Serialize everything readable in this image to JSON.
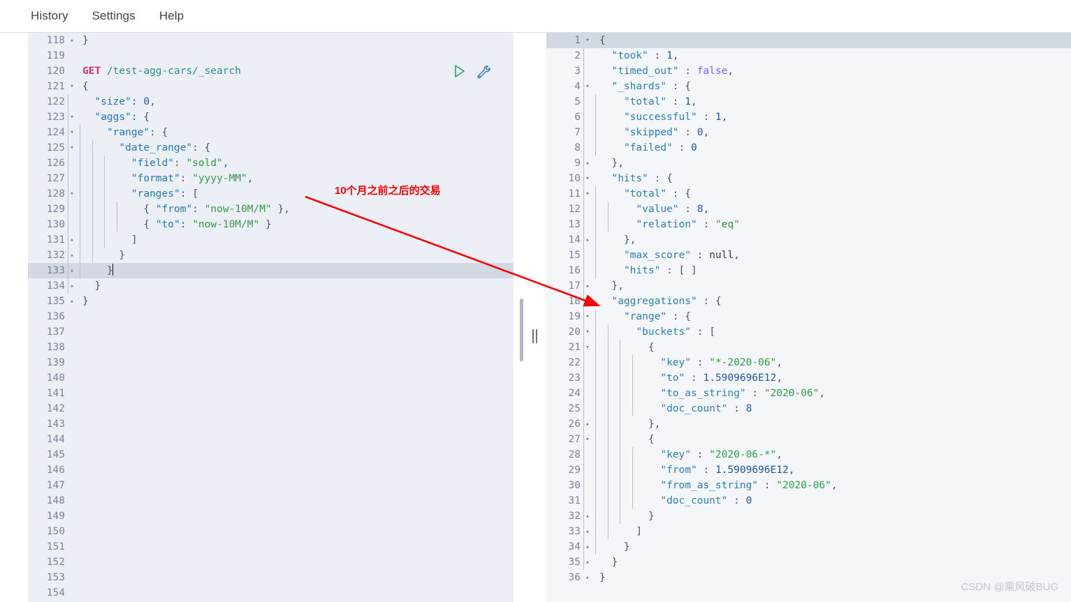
{
  "menu": {
    "items": [
      {
        "label": "History",
        "name": "menu-history"
      },
      {
        "label": "Settings",
        "name": "menu-settings"
      },
      {
        "label": "Help",
        "name": "menu-help"
      }
    ]
  },
  "request_editor": {
    "method": "GET",
    "path": "/test-agg-cars/_search",
    "active_line": 133,
    "first_line": 118,
    "last_line": 154,
    "actions": {
      "play_label": "send-request",
      "wrench_label": "request-options"
    },
    "lines": [
      {
        "n": 118,
        "fold": "up",
        "text": "}"
      },
      {
        "n": 119,
        "fold": "",
        "text": ""
      },
      {
        "n": 120,
        "fold": "",
        "text": "GET /test-agg-cars/_search"
      },
      {
        "n": 121,
        "fold": "down",
        "text": "{"
      },
      {
        "n": 122,
        "fold": "",
        "text": "  \"size\": 0,"
      },
      {
        "n": 123,
        "fold": "down",
        "text": "  \"aggs\": {"
      },
      {
        "n": 124,
        "fold": "down",
        "text": "    \"range\": {"
      },
      {
        "n": 125,
        "fold": "down",
        "text": "      \"date_range\": {"
      },
      {
        "n": 126,
        "fold": "",
        "text": "        \"field\": \"sold\","
      },
      {
        "n": 127,
        "fold": "",
        "text": "        \"format\": \"yyyy-MM\","
      },
      {
        "n": 128,
        "fold": "down",
        "text": "        \"ranges\": ["
      },
      {
        "n": 129,
        "fold": "",
        "text": "          { \"from\": \"now-10M/M\" },"
      },
      {
        "n": 130,
        "fold": "",
        "text": "          { \"to\": \"now-10M/M\" }"
      },
      {
        "n": 131,
        "fold": "up",
        "text": "        ]"
      },
      {
        "n": 132,
        "fold": "up",
        "text": "      }"
      },
      {
        "n": 133,
        "fold": "up",
        "text": "    }"
      },
      {
        "n": 134,
        "fold": "up",
        "text": "  }"
      },
      {
        "n": 135,
        "fold": "up",
        "text": "}"
      },
      {
        "n": 136,
        "fold": "",
        "text": ""
      },
      {
        "n": 137,
        "fold": "",
        "text": ""
      },
      {
        "n": 138,
        "fold": "",
        "text": ""
      },
      {
        "n": 139,
        "fold": "",
        "text": ""
      },
      {
        "n": 140,
        "fold": "",
        "text": ""
      },
      {
        "n": 141,
        "fold": "",
        "text": ""
      },
      {
        "n": 142,
        "fold": "",
        "text": ""
      },
      {
        "n": 143,
        "fold": "",
        "text": ""
      },
      {
        "n": 144,
        "fold": "",
        "text": ""
      },
      {
        "n": 145,
        "fold": "",
        "text": ""
      },
      {
        "n": 146,
        "fold": "",
        "text": ""
      },
      {
        "n": 147,
        "fold": "",
        "text": ""
      },
      {
        "n": 148,
        "fold": "",
        "text": ""
      },
      {
        "n": 149,
        "fold": "",
        "text": ""
      },
      {
        "n": 150,
        "fold": "",
        "text": ""
      },
      {
        "n": 151,
        "fold": "",
        "text": ""
      },
      {
        "n": 152,
        "fold": "",
        "text": ""
      },
      {
        "n": 153,
        "fold": "",
        "text": ""
      },
      {
        "n": 154,
        "fold": "",
        "text": ""
      }
    ]
  },
  "response_viewer": {
    "active_line": 1,
    "lines": [
      {
        "n": 1,
        "fold": "down",
        "text": "{"
      },
      {
        "n": 2,
        "fold": "",
        "text": "  \"took\" : 1,"
      },
      {
        "n": 3,
        "fold": "",
        "text": "  \"timed_out\" : false,"
      },
      {
        "n": 4,
        "fold": "down",
        "text": "  \"_shards\" : {"
      },
      {
        "n": 5,
        "fold": "",
        "text": "    \"total\" : 1,"
      },
      {
        "n": 6,
        "fold": "",
        "text": "    \"successful\" : 1,"
      },
      {
        "n": 7,
        "fold": "",
        "text": "    \"skipped\" : 0,"
      },
      {
        "n": 8,
        "fold": "",
        "text": "    \"failed\" : 0"
      },
      {
        "n": 9,
        "fold": "up",
        "text": "  },"
      },
      {
        "n": 10,
        "fold": "down",
        "text": "  \"hits\" : {"
      },
      {
        "n": 11,
        "fold": "down",
        "text": "    \"total\" : {"
      },
      {
        "n": 12,
        "fold": "",
        "text": "      \"value\" : 8,"
      },
      {
        "n": 13,
        "fold": "",
        "text": "      \"relation\" : \"eq\""
      },
      {
        "n": 14,
        "fold": "up",
        "text": "    },"
      },
      {
        "n": 15,
        "fold": "",
        "text": "    \"max_score\" : null,"
      },
      {
        "n": 16,
        "fold": "",
        "text": "    \"hits\" : [ ]"
      },
      {
        "n": 17,
        "fold": "up",
        "text": "  },"
      },
      {
        "n": 18,
        "fold": "down",
        "text": "  \"aggregations\" : {"
      },
      {
        "n": 19,
        "fold": "down",
        "text": "    \"range\" : {"
      },
      {
        "n": 20,
        "fold": "down",
        "text": "      \"buckets\" : ["
      },
      {
        "n": 21,
        "fold": "down",
        "text": "        {"
      },
      {
        "n": 22,
        "fold": "",
        "text": "          \"key\" : \"*-2020-06\","
      },
      {
        "n": 23,
        "fold": "",
        "text": "          \"to\" : 1.5909696E12,"
      },
      {
        "n": 24,
        "fold": "",
        "text": "          \"to_as_string\" : \"2020-06\","
      },
      {
        "n": 25,
        "fold": "",
        "text": "          \"doc_count\" : 8"
      },
      {
        "n": 26,
        "fold": "up",
        "text": "        },"
      },
      {
        "n": 27,
        "fold": "down",
        "text": "        {"
      },
      {
        "n": 28,
        "fold": "",
        "text": "          \"key\" : \"2020-06-*\","
      },
      {
        "n": 29,
        "fold": "",
        "text": "          \"from\" : 1.5909696E12,"
      },
      {
        "n": 30,
        "fold": "",
        "text": "          \"from_as_string\" : \"2020-06\","
      },
      {
        "n": 31,
        "fold": "",
        "text": "          \"doc_count\" : 0"
      },
      {
        "n": 32,
        "fold": "up",
        "text": "        }"
      },
      {
        "n": 33,
        "fold": "up",
        "text": "      ]"
      },
      {
        "n": 34,
        "fold": "up",
        "text": "    }"
      },
      {
        "n": 35,
        "fold": "up",
        "text": "  }"
      },
      {
        "n": 36,
        "fold": "up",
        "text": "}"
      }
    ]
  },
  "annotation": {
    "text": "10个月之前之后的交易",
    "color": "#ff0000"
  },
  "watermark": {
    "text": "CSDN @乘风破BUG"
  },
  "colors": {
    "editor_bg": "#edeff7",
    "response_bg": "#f5f6fa",
    "active_line": "#d3d9e3",
    "gutter_text": "#77849a",
    "method": "#d6336c",
    "url": "#2f8f8f",
    "key": "#1f7ab5",
    "string": "#2f9e44",
    "number": "#2257a8",
    "boolean": "#7b61ff",
    "annotation": "#ff0000"
  }
}
